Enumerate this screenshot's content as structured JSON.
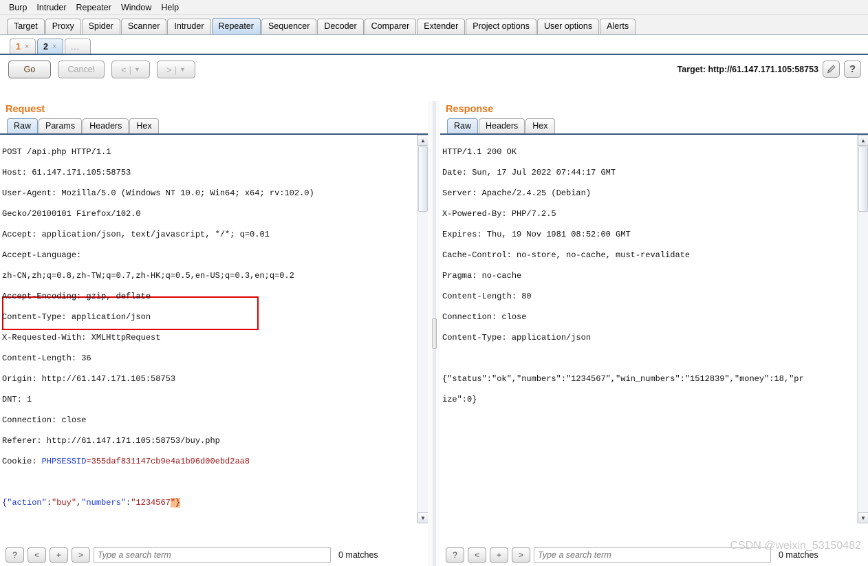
{
  "menubar": {
    "items": [
      "Burp",
      "Intruder",
      "Repeater",
      "Window",
      "Help"
    ]
  },
  "main_tabs": {
    "selected": "Repeater",
    "items": [
      "Target",
      "Proxy",
      "Spider",
      "Scanner",
      "Intruder",
      "Repeater",
      "Sequencer",
      "Decoder",
      "Comparer",
      "Extender",
      "Project options",
      "User options",
      "Alerts"
    ]
  },
  "repeater_tabs": {
    "selected": "2",
    "items": [
      {
        "label": "1",
        "close": "×"
      },
      {
        "label": "2",
        "close": "×"
      }
    ],
    "add_label": "..."
  },
  "actions": {
    "go_label": "Go",
    "cancel_label": "Cancel",
    "back_label": "<",
    "forward_label": ">",
    "separator": "|",
    "caret": "▼"
  },
  "target": {
    "label": "Target: http://61.147.171.105:58753",
    "edit_icon": "pencil-icon",
    "help_icon": "?"
  },
  "request": {
    "title": "Request",
    "tabs": [
      "Raw",
      "Params",
      "Headers",
      "Hex"
    ],
    "selected_tab": "Raw",
    "lines": [
      "POST /api.php HTTP/1.1",
      "Host: 61.147.171.105:58753",
      "User-Agent: Mozilla/5.0 (Windows NT 10.0; Win64; x64; rv:102.0)",
      "Gecko/20100101 Firefox/102.0",
      "Accept: application/json, text/javascript, */*; q=0.01",
      "Accept-Language:",
      "zh-CN,zh;q=0.8,zh-TW;q=0.7,zh-HK;q=0.5,en-US;q=0.3,en;q=0.2",
      "Accept-Encoding: gzip, deflate",
      "Content-Type: application/json",
      "X-Requested-With: XMLHttpRequest",
      "Content-Length: 36",
      "Origin: http://61.147.171.105:58753",
      "DNT: 1",
      "Connection: close",
      "Referer: http://61.147.171.105:58753/buy.php"
    ],
    "cookie_label": "Cookie: ",
    "cookie_name": "PHPSESSID",
    "cookie_eq": "=",
    "cookie_value": "355daf831147cb9e4a1b96d00ebd2aa8",
    "body": {
      "open_brace": "{",
      "key1": "\"action\"",
      "colon1": ":",
      "val1": "\"buy\"",
      "comma": ",",
      "key2": "\"numbers\"",
      "colon2": ":",
      "val2": "\"1234567",
      "highlight": "\"}"
    },
    "search_placeholder": "Type a search term",
    "matches": "0 matches",
    "search_buttons": [
      "?",
      "<",
      "+",
      ">"
    ]
  },
  "response": {
    "title": "Response",
    "tabs": [
      "Raw",
      "Headers",
      "Hex"
    ],
    "selected_tab": "Raw",
    "lines": [
      "HTTP/1.1 200 OK",
      "Date: Sun, 17 Jul 2022 07:44:17 GMT",
      "Server: Apache/2.4.25 (Debian)",
      "X-Powered-By: PHP/7.2.5",
      "Expires: Thu, 19 Nov 1981 08:52:00 GMT",
      "Cache-Control: no-store, no-cache, must-revalidate",
      "Pragma: no-cache",
      "Content-Length: 80",
      "Connection: close",
      "Content-Type: application/json",
      "",
      "{\"status\":\"ok\",\"numbers\":\"1234567\",\"win_numbers\":\"1512839\",\"money\":18,\"pr",
      "ize\":0}"
    ],
    "search_placeholder": "Type a search term",
    "matches": "0 matches",
    "search_buttons": [
      "?",
      "<",
      "+",
      ">"
    ]
  },
  "watermark": "CSDN @weixin_53150482",
  "colors": {
    "accent_orange": "#e8761a",
    "tab_selected": "#c3d9f0",
    "highlight_box": "#dd0000",
    "json_key": "#1a35d6",
    "json_value": "#9a1010",
    "selection_highlight": "#fbc08a"
  }
}
